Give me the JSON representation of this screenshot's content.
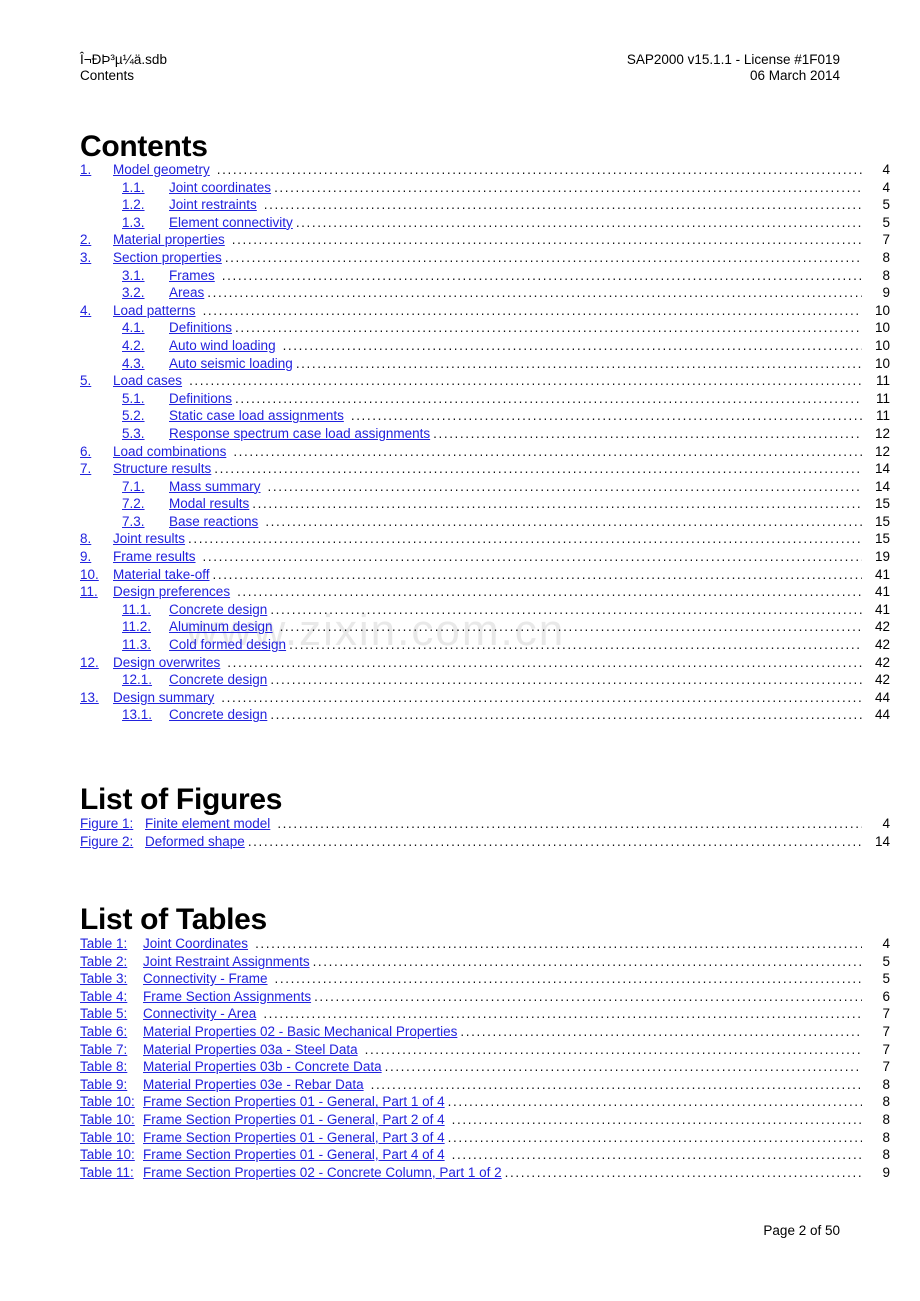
{
  "header": {
    "file_name": "Î¬ÐÞ³µ¼ä.sdb",
    "doc_section": "Contents",
    "program": "SAP2000 v15.1.1 - License #1F019",
    "date": "06 March 2014"
  },
  "watermark": "www.zixin.com.cn",
  "footer": {
    "page_label": "Page 2 of 50"
  },
  "contents": {
    "heading": "Contents",
    "entries": [
      {
        "level": 1,
        "number": "1.",
        "label": "Model geometry",
        "page": "4"
      },
      {
        "level": 2,
        "number": "1.1.",
        "label": "Joint coordinates",
        "page": "4"
      },
      {
        "level": 2,
        "number": "1.2.",
        "label": "Joint restraints",
        "page": "5"
      },
      {
        "level": 2,
        "number": "1.3.",
        "label": "Element connectivity",
        "page": "5"
      },
      {
        "level": 1,
        "number": "2.",
        "label": "Material properties",
        "page": "7"
      },
      {
        "level": 1,
        "number": "3.",
        "label": "Section properties",
        "page": "8"
      },
      {
        "level": 2,
        "number": "3.1.",
        "label": "Frames",
        "page": "8"
      },
      {
        "level": 2,
        "number": "3.2.",
        "label": "Areas",
        "page": "9"
      },
      {
        "level": 1,
        "number": "4.",
        "label": "Load patterns",
        "page": "10"
      },
      {
        "level": 2,
        "number": "4.1.",
        "label": "Definitions",
        "page": "10"
      },
      {
        "level": 2,
        "number": "4.2.",
        "label": "Auto wind loading",
        "page": "10"
      },
      {
        "level": 2,
        "number": "4.3.",
        "label": "Auto seismic loading",
        "page": "10"
      },
      {
        "level": 1,
        "number": "5.",
        "label": "Load cases",
        "page": "11"
      },
      {
        "level": 2,
        "number": "5.1.",
        "label": "Definitions",
        "page": "11"
      },
      {
        "level": 2,
        "number": "5.2.",
        "label": "Static case load assignments",
        "page": "11"
      },
      {
        "level": 2,
        "number": "5.3.",
        "label": "Response spectrum case load assignments",
        "page": "12"
      },
      {
        "level": 1,
        "number": "6.",
        "label": "Load combinations",
        "page": "12"
      },
      {
        "level": 1,
        "number": "7.",
        "label": "Structure results",
        "page": "14"
      },
      {
        "level": 2,
        "number": "7.1.",
        "label": "Mass summary",
        "page": "14"
      },
      {
        "level": 2,
        "number": "7.2.",
        "label": "Modal results",
        "page": "15"
      },
      {
        "level": 2,
        "number": "7.3.",
        "label": "Base reactions",
        "page": "15"
      },
      {
        "level": 1,
        "number": "8.",
        "label": "Joint results",
        "page": "15"
      },
      {
        "level": 1,
        "number": "9.",
        "label": "Frame results",
        "page": "19"
      },
      {
        "level": 1,
        "number": "10.",
        "label": "Material take-off",
        "page": "41"
      },
      {
        "level": 1,
        "number": "11.",
        "label": "Design preferences",
        "page": "41"
      },
      {
        "level": 2,
        "number": "11.1.",
        "label": "Concrete design",
        "page": "41"
      },
      {
        "level": 2,
        "number": "11.2.",
        "label": "Aluminum design",
        "page": "42"
      },
      {
        "level": 2,
        "number": "11.3.",
        "label": "Cold formed design",
        "page": "42"
      },
      {
        "level": 1,
        "number": "12.",
        "label": "Design overwrites",
        "page": "42"
      },
      {
        "level": 2,
        "number": "12.1.",
        "label": "Concrete design",
        "page": "42"
      },
      {
        "level": 1,
        "number": "13.",
        "label": "Design summary",
        "page": "44"
      },
      {
        "level": 2,
        "number": "13.1.",
        "label": "Concrete design",
        "page": "44"
      }
    ]
  },
  "figures": {
    "heading": "List of Figures",
    "entries": [
      {
        "number": "Figure 1:",
        "label": "Finite element model",
        "page": "4"
      },
      {
        "number": "Figure 2:",
        "label": "Deformed shape",
        "page": "14"
      }
    ]
  },
  "tables": {
    "heading": "List of Tables",
    "entries": [
      {
        "number": "Table 1:",
        "label": "Joint Coordinates",
        "page": "4"
      },
      {
        "number": "Table 2:",
        "label": "Joint Restraint Assignments",
        "page": "5"
      },
      {
        "number": "Table 3:",
        "label": "Connectivity - Frame",
        "page": "5"
      },
      {
        "number": "Table 4:",
        "label": "Frame Section Assignments",
        "page": "6"
      },
      {
        "number": "Table 5:",
        "label": "Connectivity - Area",
        "page": "7"
      },
      {
        "number": "Table 6:",
        "label": "Material Properties 02 - Basic Mechanical Properties",
        "page": "7"
      },
      {
        "number": "Table 7:",
        "label": "Material Properties 03a - Steel Data",
        "page": "7"
      },
      {
        "number": "Table 8:",
        "label": "Material Properties 03b - Concrete Data",
        "page": "7"
      },
      {
        "number": "Table 9:",
        "label": "Material Properties 03e - Rebar Data",
        "page": "8"
      },
      {
        "number": "Table 10:",
        "label": "Frame Section Properties 01 - General, Part 1 of 4",
        "page": "8"
      },
      {
        "number": "Table 10:",
        "label": "Frame Section Properties 01 - General, Part 2 of 4",
        "page": "8"
      },
      {
        "number": "Table 10:",
        "label": "Frame Section Properties 01 - General, Part 3 of 4",
        "page": "8"
      },
      {
        "number": "Table 10:",
        "label": "Frame Section Properties 01 - General, Part 4 of 4",
        "page": "8"
      },
      {
        "number": "Table 11:",
        "label": "Frame Section Properties 02 - Concrete Column, Part 1 of 2",
        "page": "9"
      }
    ]
  },
  "colors": {
    "link": "#2222dd",
    "watermark": "#e9e9e9",
    "text": "#000000"
  }
}
